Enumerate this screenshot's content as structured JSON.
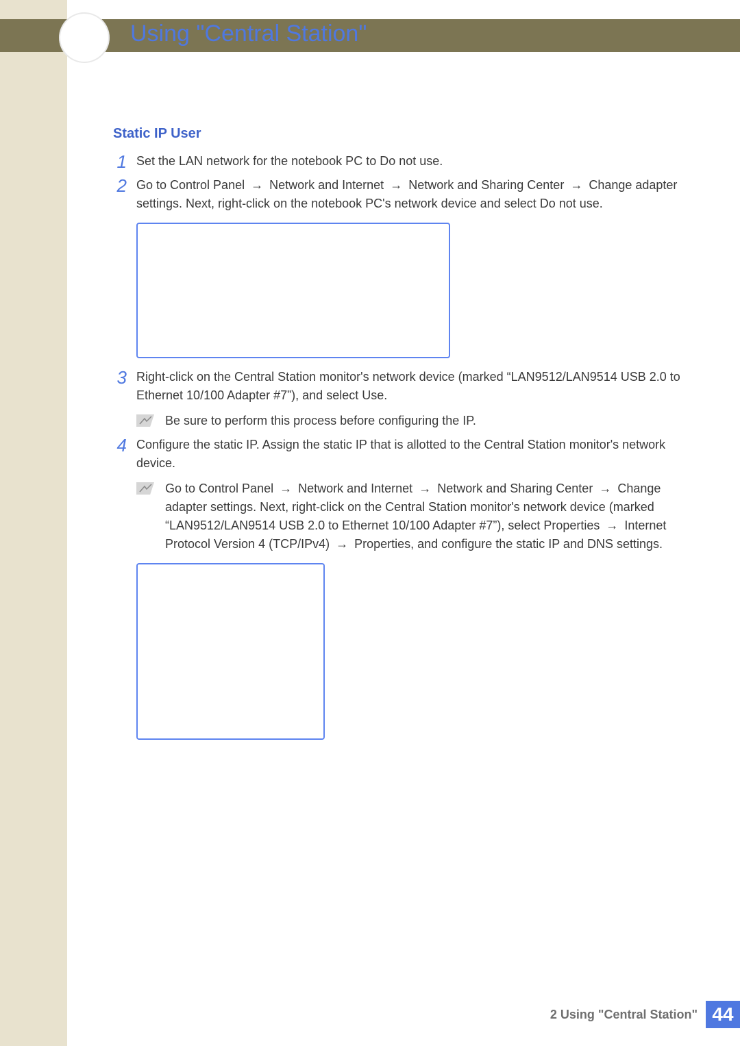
{
  "header": {
    "chapter_title": "Using \"Central Station\""
  },
  "section": {
    "heading": "Static IP User",
    "arrow": "→",
    "steps": {
      "s1": {
        "num": "1",
        "text": "Set the LAN network for the notebook PC to Do not use."
      },
      "s2": {
        "num": "2",
        "p1a": "Go to Control Panel ",
        "p1b": " Network and Internet ",
        "p1c": " Network and Sharing Center ",
        "p1d": " Change adapter settings. Next, right-click on the notebook PC's network device and select Do not use."
      },
      "s3": {
        "num": "3",
        "text": "Right-click on the Central Station monitor's network device (marked “LAN9512/LAN9514 USB 2.0 to Ethernet 10/100 Adapter #7”), and select Use.",
        "note": "Be sure to perform this process before configuring the IP."
      },
      "s4": {
        "num": "4",
        "text": "Configure the static IP. Assign the static IP that is allotted to the Central Station monitor's network device.",
        "note_a": "Go to Control Panel ",
        "note_b": " Network and Internet ",
        "note_c": " Network and Sharing Center ",
        "note_d": " Change adapter settings. Next, right-click on the Central Station monitor's network device (marked “LAN9512/LAN9514 USB 2.0 to Ethernet 10/100 Adapter #7”), select Properties ",
        "note_e": " Internet Protocol Version 4 (TCP/IPv4) ",
        "note_f": " Properties, and configure the static IP and DNS settings."
      }
    }
  },
  "footer": {
    "label": "2 Using \"Central Station\"",
    "page_number": "44"
  }
}
